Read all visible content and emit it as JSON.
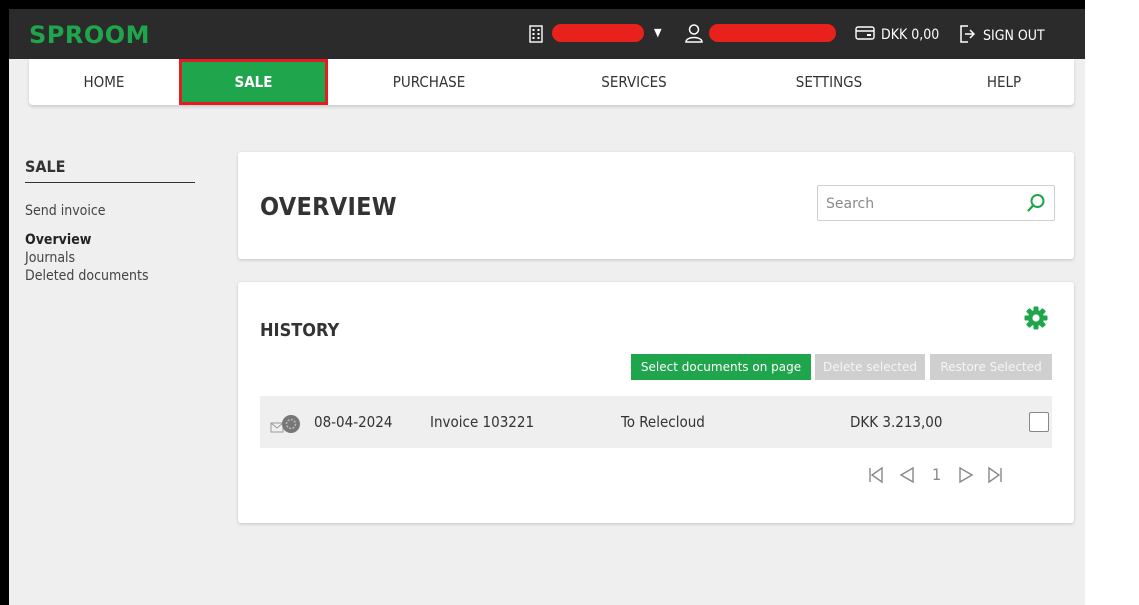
{
  "app": {
    "logo": "SPROOM",
    "balance": "DKK 0,00",
    "sign_out": "SIGN OUT"
  },
  "nav": {
    "items": [
      {
        "label": "HOME"
      },
      {
        "label": "SALE"
      },
      {
        "label": "PURCHASE"
      },
      {
        "label": "SERVICES"
      },
      {
        "label": "SETTINGS"
      },
      {
        "label": "HELP"
      }
    ]
  },
  "sidebar": {
    "title": "SALE",
    "links": [
      "Send invoice",
      "Overview",
      "Journals",
      "Deleted documents"
    ]
  },
  "overview": {
    "title": "OVERVIEW",
    "search_placeholder": "Search"
  },
  "history": {
    "title": "HISTORY",
    "select_button": "Select documents on page",
    "delete_button": "Delete selected",
    "restore_button": "Restore Selected",
    "rows": [
      {
        "date": "08-04-2024",
        "document": "Invoice 103221",
        "recipient": "To Relecloud",
        "amount": "DKK 3.213,00"
      }
    ],
    "page": "1"
  },
  "colors": {
    "brand_green": "#1fa54b",
    "topbar": "#2b2b2b",
    "highlight_red": "#e21c22"
  }
}
